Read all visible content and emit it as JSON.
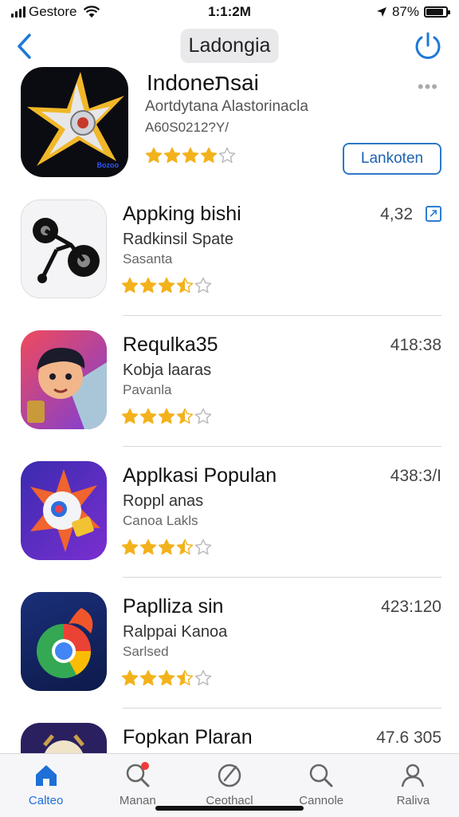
{
  "status": {
    "carrier": "Gestore",
    "time": "1:1:2M",
    "battery": "87%",
    "battery_level": 0.87
  },
  "nav": {
    "title": "Ladongia"
  },
  "featured": {
    "title": "Indoneתsai",
    "subtitle": "Aortdytana Alastorinacla",
    "meta": "A60S0212?Y/",
    "rating": 4,
    "icon_tag": "Bozoo",
    "button_label": "Lankoten"
  },
  "apps": [
    {
      "title": "Appking bishi",
      "subtitle": "Radkinsil Spate",
      "meta": "Sasanta",
      "size": "4,32",
      "rating": 3.5,
      "icon": "bicycle-icon",
      "download": true
    },
    {
      "title": "Requlka35",
      "subtitle": "Kobja laaras",
      "meta": "Pavanla",
      "size": "418:38",
      "rating": 3.5,
      "icon": "cartoon-boy-icon",
      "download": false
    },
    {
      "title": "Applkasi Populan",
      "subtitle": "Roppl anas",
      "meta": "Canoa Lakls",
      "size": "438:3/I",
      "rating": 3.5,
      "icon": "star-lock-icon",
      "download": false
    },
    {
      "title": "Paplliza sin",
      "subtitle": "Ralppai Kanoa",
      "meta": "Sarlsed",
      "size": "423:120",
      "rating": 3.5,
      "icon": "chrome-icon",
      "download": false
    },
    {
      "title": "Fopkan Plaran",
      "subtitle": "",
      "meta": "",
      "size": "47.6 305",
      "rating": 0,
      "icon": "face-icon",
      "download": false
    }
  ],
  "tabs": [
    {
      "label": "Calteo",
      "icon": "home-icon",
      "active": true
    },
    {
      "label": "Manan",
      "icon": "search-icon",
      "active": false,
      "badge": true
    },
    {
      "label": "Ceothacl",
      "icon": "compass-icon",
      "active": false
    },
    {
      "label": "Cannole",
      "icon": "search-icon",
      "active": false
    },
    {
      "label": "Raliva",
      "icon": "person-icon",
      "active": false
    }
  ],
  "colors": {
    "accent": "#1e6fd6",
    "star": "#f3b21c",
    "star_empty": "#b8b8bc"
  }
}
